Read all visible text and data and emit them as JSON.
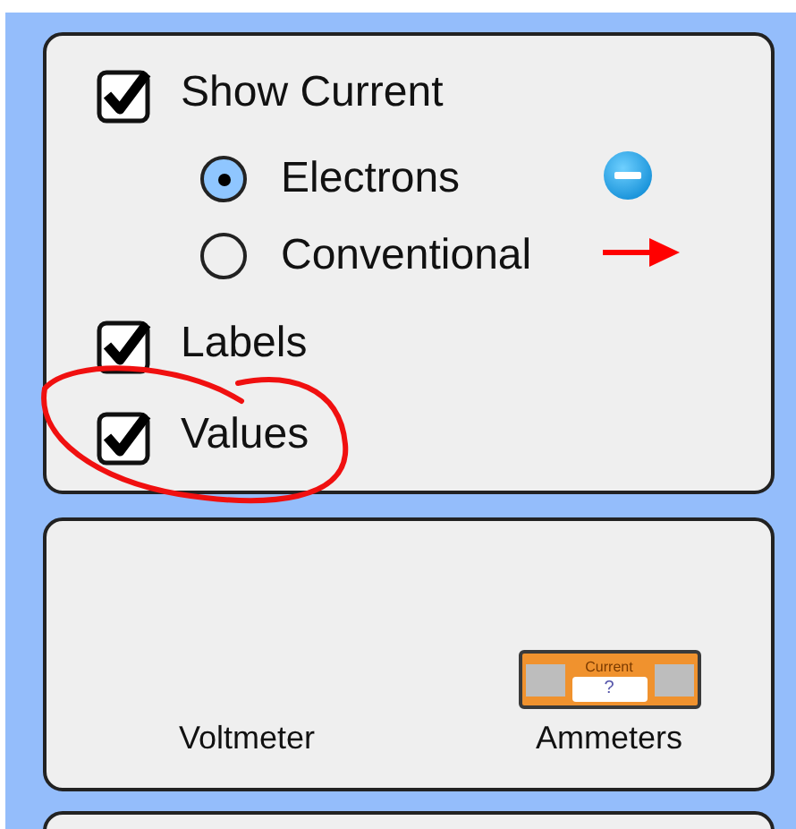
{
  "show_current": {
    "label": "Show Current",
    "checked": true
  },
  "current_types": [
    {
      "label": "Electrons",
      "selected": true,
      "kind": "electron"
    },
    {
      "label": "Conventional",
      "selected": false,
      "kind": "arrow"
    }
  ],
  "options": [
    {
      "label": "Labels",
      "checked": true
    },
    {
      "label": "Values",
      "checked": true
    }
  ],
  "tools": [
    {
      "label": "Voltmeter",
      "kind": "empty"
    },
    {
      "label": "Ammeters",
      "kind": "ammeter",
      "meter_title": "Current",
      "meter_value": "?"
    }
  ]
}
